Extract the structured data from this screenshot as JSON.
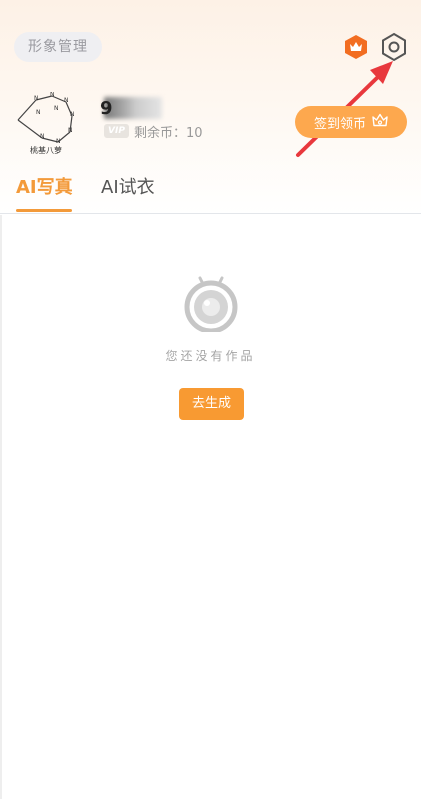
{
  "header": {
    "pill_label": "形象管理",
    "vip_icon": "vip-crown-icon",
    "settings_icon": "settings-hexagon-icon"
  },
  "profile": {
    "avatar_caption": "桃基八萝",
    "username_visible": "9",
    "vip_label": "VIP",
    "coins_text": "剩余币：10",
    "checkin_label": "签到领币"
  },
  "tabs": [
    {
      "label": "AI写真",
      "active": true
    },
    {
      "label": "AI试衣",
      "active": false
    }
  ],
  "empty_state": {
    "message": "您还没有作品",
    "button_label": "去生成"
  },
  "colors": {
    "accent": "#f39a3a",
    "arrow": "#e8383d",
    "checkin_button": "#fda84e"
  }
}
